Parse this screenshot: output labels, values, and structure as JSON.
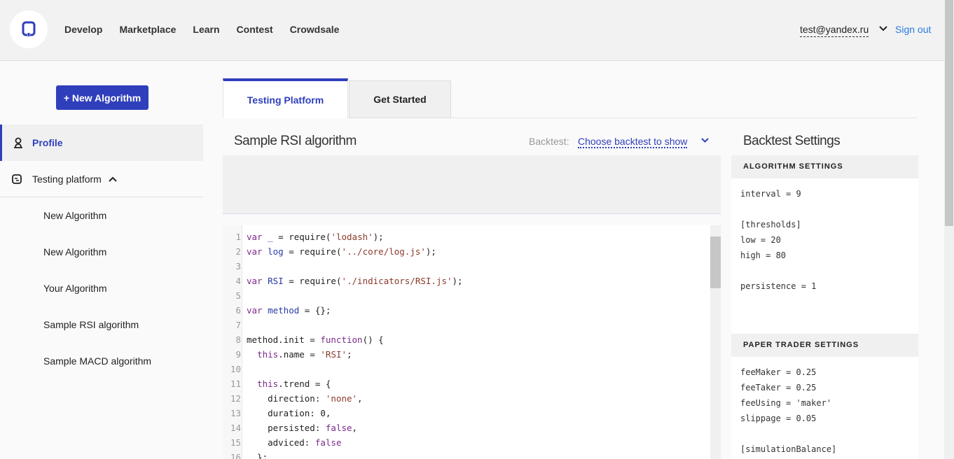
{
  "header": {
    "nav": [
      "Develop",
      "Marketplace",
      "Learn",
      "Contest",
      "Crowdsale"
    ],
    "user_email": "test@yandex.ru",
    "sign_out": "Sign out"
  },
  "sidebar": {
    "new_button": "+ New Algorithm",
    "profile": "Profile",
    "testing_platform": "Testing platform",
    "items": [
      "New Algorithm",
      "New Algorithm",
      "Your Algorithm",
      "Sample RSI algorithm",
      "Sample MACD algorithm"
    ]
  },
  "tabs": [
    "Testing Platform",
    "Get Started"
  ],
  "main": {
    "title": "Sample RSI algorithm",
    "backtest_label": "Backtest:",
    "backtest_select": "Choose backtest to show",
    "code": [
      "var _ = require('lodash');",
      "var log = require('../core/log.js');",
      "",
      "var RSI = require('./indicators/RSI.js');",
      "",
      "var method = {};",
      "",
      "method.init = function() {",
      "  this.name = 'RSI';",
      "",
      "  this.trend = {",
      "    direction: 'none',",
      "    duration: 0,",
      "    persisted: false,",
      "    adviced: false",
      "  };"
    ]
  },
  "settings": {
    "title": "Backtest Settings",
    "algorithm_header": "ALGORITHM SETTINGS",
    "algorithm_lines": [
      "interval = 9",
      "",
      "[thresholds]",
      "low = 20",
      "high = 80",
      "",
      "persistence = 1"
    ],
    "paper_header": "PAPER TRADER SETTINGS",
    "paper_lines": [
      "feeMaker = 0.25",
      "feeTaker = 0.25",
      "feeUsing = 'maker'",
      "slippage = 0.05",
      "",
      "[simulationBalance]"
    ]
  },
  "colors": {
    "accent": "#2f3fbc",
    "link": "#2c7be5"
  }
}
